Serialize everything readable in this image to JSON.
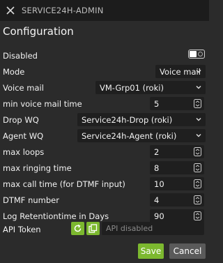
{
  "window": {
    "title": "SERVICE24H-ADMIN"
  },
  "heading": "Configuration",
  "fields": {
    "disabled": {
      "label": "Disabled",
      "on": false
    },
    "mode": {
      "label": "Mode",
      "value": "Voice mail"
    },
    "voice_mail": {
      "label": "Voice mail",
      "value": "VM-Grp01 (roki)"
    },
    "min_voice_mail_time": {
      "label": "min voice mail time",
      "value": "5"
    },
    "drop_wq": {
      "label": "Drop WQ",
      "value": "Service24h-Drop (roki)"
    },
    "agent_wq": {
      "label": "Agent WQ",
      "value": "Service24h-Agent (roki)"
    },
    "max_loops": {
      "label": "max loops",
      "value": "2"
    },
    "max_ringing_time": {
      "label": "max ringing time",
      "value": "8"
    },
    "max_call_time": {
      "label": "max call time (for DTMF input)",
      "value": "10"
    },
    "dtmf_number": {
      "label": "DTMF number",
      "value": "4"
    },
    "log_retention": {
      "label": "Log Retentiontime in Days",
      "value": "90"
    },
    "api_token": {
      "label": "API Token",
      "placeholder": "API disabled"
    }
  },
  "buttons": {
    "save": "Save",
    "cancel": "Cancel"
  },
  "colors": {
    "accent": "#7cb82f",
    "background": "#2b2b2b",
    "field": "#1f1f1f",
    "cancel": "#5a5a5a"
  },
  "icons": {
    "close": "close-icon",
    "refresh": "refresh-icon",
    "copy": "copy-icon",
    "chevron": "chevron-down-icon",
    "spinner": "stepper-icon"
  }
}
